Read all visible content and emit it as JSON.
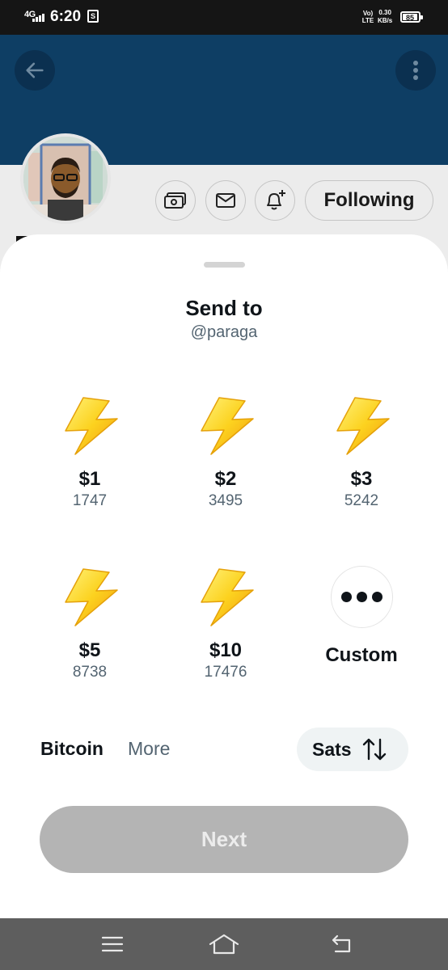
{
  "status_bar": {
    "network": "4G",
    "time": "6:20",
    "volte": "Vo) LTE",
    "speed_value": "0.30",
    "speed_unit": "KB/s",
    "battery": "85"
  },
  "profile": {
    "following_label": "Following"
  },
  "sheet": {
    "title": "Send to",
    "handle": "@paraga",
    "amounts": [
      {
        "usd": "$1",
        "sats": "1747"
      },
      {
        "usd": "$2",
        "sats": "3495"
      },
      {
        "usd": "$3",
        "sats": "5242"
      },
      {
        "usd": "$5",
        "sats": "8738"
      },
      {
        "usd": "$10",
        "sats": "17476"
      }
    ],
    "custom_label": "Custom",
    "tabs": {
      "bitcoin": "Bitcoin",
      "more": "More"
    },
    "unit_toggle_label": "Sats",
    "next_label": "Next"
  },
  "icons": {
    "back": "arrow-left-icon",
    "overflow": "more-vertical-icon",
    "tip": "money-icon",
    "message": "envelope-icon",
    "notify": "bell-plus-icon",
    "amount": "lightning-bolt-icon",
    "custom": "ellipsis-icon",
    "swap": "swap-vertical-icon",
    "nav_menu": "menu-icon",
    "nav_home": "home-icon",
    "nav_back": "back-icon"
  },
  "colors": {
    "banner": "#0e3e64",
    "text_primary": "#0f1419",
    "text_secondary": "#536471",
    "next_disabled": "#b4b4b4",
    "bolt": "#f6c21c"
  }
}
